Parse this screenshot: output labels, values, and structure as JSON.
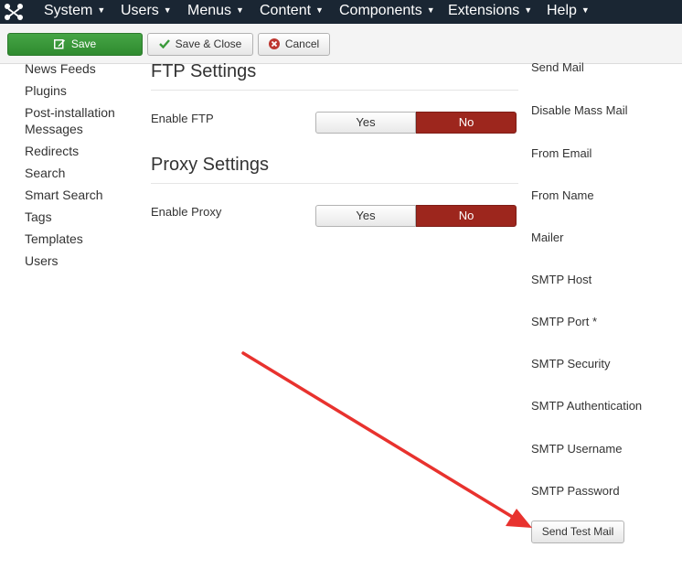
{
  "navbar": {
    "items": [
      {
        "label": "System"
      },
      {
        "label": "Users"
      },
      {
        "label": "Menus"
      },
      {
        "label": "Content"
      },
      {
        "label": "Components"
      },
      {
        "label": "Extensions"
      },
      {
        "label": "Help"
      }
    ],
    "logo_icon": "joomla-logo-icon"
  },
  "toolbar": {
    "save_label": "Save",
    "save_close_label": "Save & Close",
    "cancel_label": "Cancel"
  },
  "sidebar": {
    "items": [
      {
        "label": "News Feeds"
      },
      {
        "label": "Plugins"
      },
      {
        "label": "Post-installation Messages"
      },
      {
        "label": "Redirects"
      },
      {
        "label": "Search"
      },
      {
        "label": "Smart Search"
      },
      {
        "label": "Tags"
      },
      {
        "label": "Templates"
      },
      {
        "label": "Users"
      }
    ]
  },
  "ftp": {
    "title": "FTP Settings",
    "enable_label": "Enable FTP",
    "yes_label": "Yes",
    "no_label": "No",
    "selected": "No"
  },
  "proxy": {
    "title": "Proxy Settings",
    "enable_label": "Enable Proxy",
    "yes_label": "Yes",
    "no_label": "No",
    "selected": "No"
  },
  "mail": {
    "labels": [
      {
        "label": "Send Mail"
      },
      {
        "label": "Disable Mass Mail"
      },
      {
        "label": "From Email"
      },
      {
        "label": "From Name"
      },
      {
        "label": "Mailer"
      },
      {
        "label": "SMTP Host"
      },
      {
        "label": "SMTP Port *"
      },
      {
        "label": "SMTP Security"
      },
      {
        "label": "SMTP Authentication"
      },
      {
        "label": "SMTP Username"
      },
      {
        "label": "SMTP Password"
      }
    ],
    "send_test_label": "Send Test Mail"
  },
  "colors": {
    "navbar_bg": "#1a2633",
    "save_green": "#46a546",
    "toggle_no_red": "#9d261d",
    "annotation_arrow": "#e8322e"
  }
}
